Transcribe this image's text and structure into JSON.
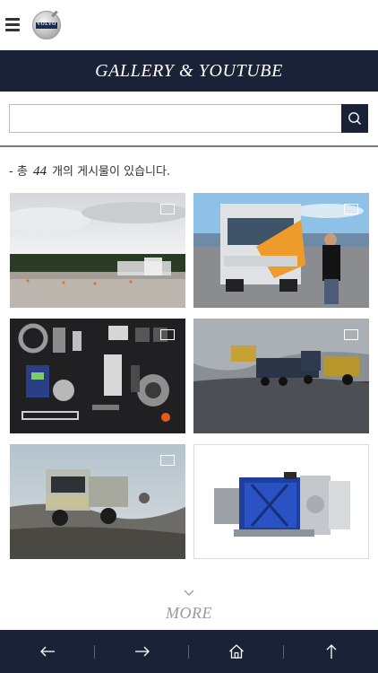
{
  "header": {
    "menu_icon": "hamburger-menu-icon",
    "logo_text": "VOLVO"
  },
  "banner": {
    "title": "GALLERY & YOUTUBE"
  },
  "search": {
    "value": "",
    "placeholder": "",
    "button_icon": "search-icon"
  },
  "summary": {
    "prefix": "- 총",
    "count": "44",
    "suffix": "개의 게시물이 있습니다."
  },
  "gallery": {
    "items": [
      {
        "subject": "truck-on-test-track",
        "expand_icon": "expand-icon"
      },
      {
        "subject": "custom-truck-with-man",
        "expand_icon": "expand-icon"
      },
      {
        "subject": "truck-parts-layout",
        "expand_icon": "expand-icon"
      },
      {
        "subject": "trucks-in-quarry",
        "expand_icon": "expand-icon"
      },
      {
        "subject": "truck-offroad",
        "expand_icon": "expand-icon"
      },
      {
        "subject": "gearbox-transmission",
        "expand_icon": "expand-icon"
      }
    ]
  },
  "more": {
    "label": "MORE",
    "icon": "chevron-down-icon"
  },
  "bottom_nav": [
    {
      "icon": "arrow-left-icon",
      "action": "back"
    },
    {
      "icon": "arrow-right-icon",
      "action": "forward"
    },
    {
      "icon": "home-icon",
      "action": "home"
    },
    {
      "icon": "arrow-up-icon",
      "action": "top"
    }
  ],
  "colors": {
    "navy": "#1a2238",
    "divider": "#7b7b7b",
    "more_text": "#9a9a9a"
  }
}
